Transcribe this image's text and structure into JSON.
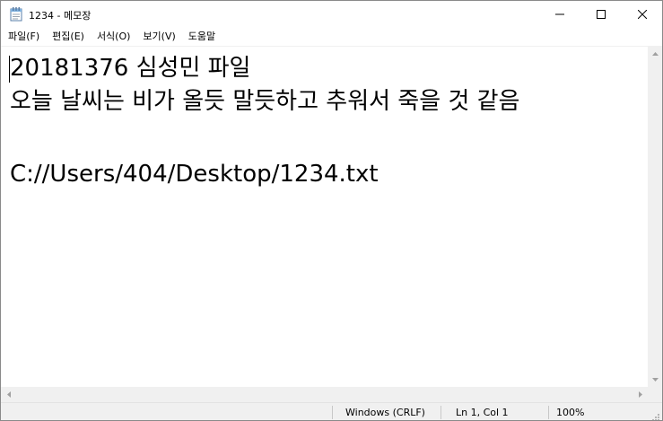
{
  "window": {
    "title": "1234 - 메모장",
    "icons": {
      "app": "notepad-icon",
      "minimize": "minimize-icon",
      "maximize": "maximize-icon",
      "close": "close-icon"
    }
  },
  "menu": {
    "items": [
      {
        "label": "파일(F)"
      },
      {
        "label": "편집(E)"
      },
      {
        "label": "서식(O)"
      },
      {
        "label": "보기(V)"
      },
      {
        "label": "도움말"
      }
    ]
  },
  "editor": {
    "lines": [
      "20181376 심성민 파일",
      "오늘 날씨는 비가 올듯 말듯하고 추워서 죽을 것 같음",
      "",
      "C://Users/404/Desktop/1234.txt"
    ]
  },
  "status": {
    "encoding": "Windows (CRLF)",
    "position": "Ln 1, Col 1",
    "zoom": "100%"
  },
  "colors": {
    "background": "#ffffff",
    "chrome": "#f0f0f0",
    "text": "#000000"
  }
}
